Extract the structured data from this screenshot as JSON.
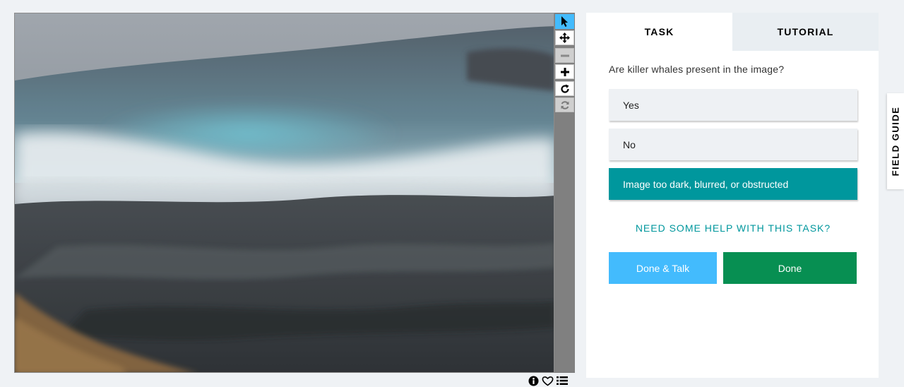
{
  "viewer": {
    "image_alt": "Stormy sea with waves crashing onto dark rocky shore",
    "tools": [
      {
        "name": "annotate",
        "icon": "pointer-icon",
        "state": "active"
      },
      {
        "name": "pan",
        "icon": "move-icon",
        "state": "normal"
      },
      {
        "name": "zoom-out",
        "icon": "minus-icon",
        "state": "disabled"
      },
      {
        "name": "zoom-in",
        "icon": "plus-icon",
        "state": "normal"
      },
      {
        "name": "rotate",
        "icon": "rotate-icon",
        "state": "normal"
      },
      {
        "name": "reset",
        "icon": "refresh-icon",
        "state": "disabled"
      }
    ],
    "meta_icons": [
      "info-icon",
      "heart-icon",
      "list-icon"
    ]
  },
  "panel": {
    "tabs": [
      {
        "label": "TASK",
        "active": true
      },
      {
        "label": "TUTORIAL",
        "active": false
      }
    ],
    "question": "Are killer whales present in the image?",
    "answers": [
      {
        "label": "Yes",
        "selected": false
      },
      {
        "label": "No",
        "selected": false
      },
      {
        "label": "Image too dark, blurred, or obstructed",
        "selected": true
      }
    ],
    "help_link": "NEED SOME HELP WITH THIS TASK?",
    "done_talk_label": "Done & Talk",
    "done_label": "Done"
  },
  "field_guide": {
    "label": "FIELD GUIDE"
  },
  "colors": {
    "accent_teal": "#00979d",
    "talk_blue": "#43bbfd",
    "done_green": "#078f52",
    "page_bg": "#eff2f5"
  }
}
